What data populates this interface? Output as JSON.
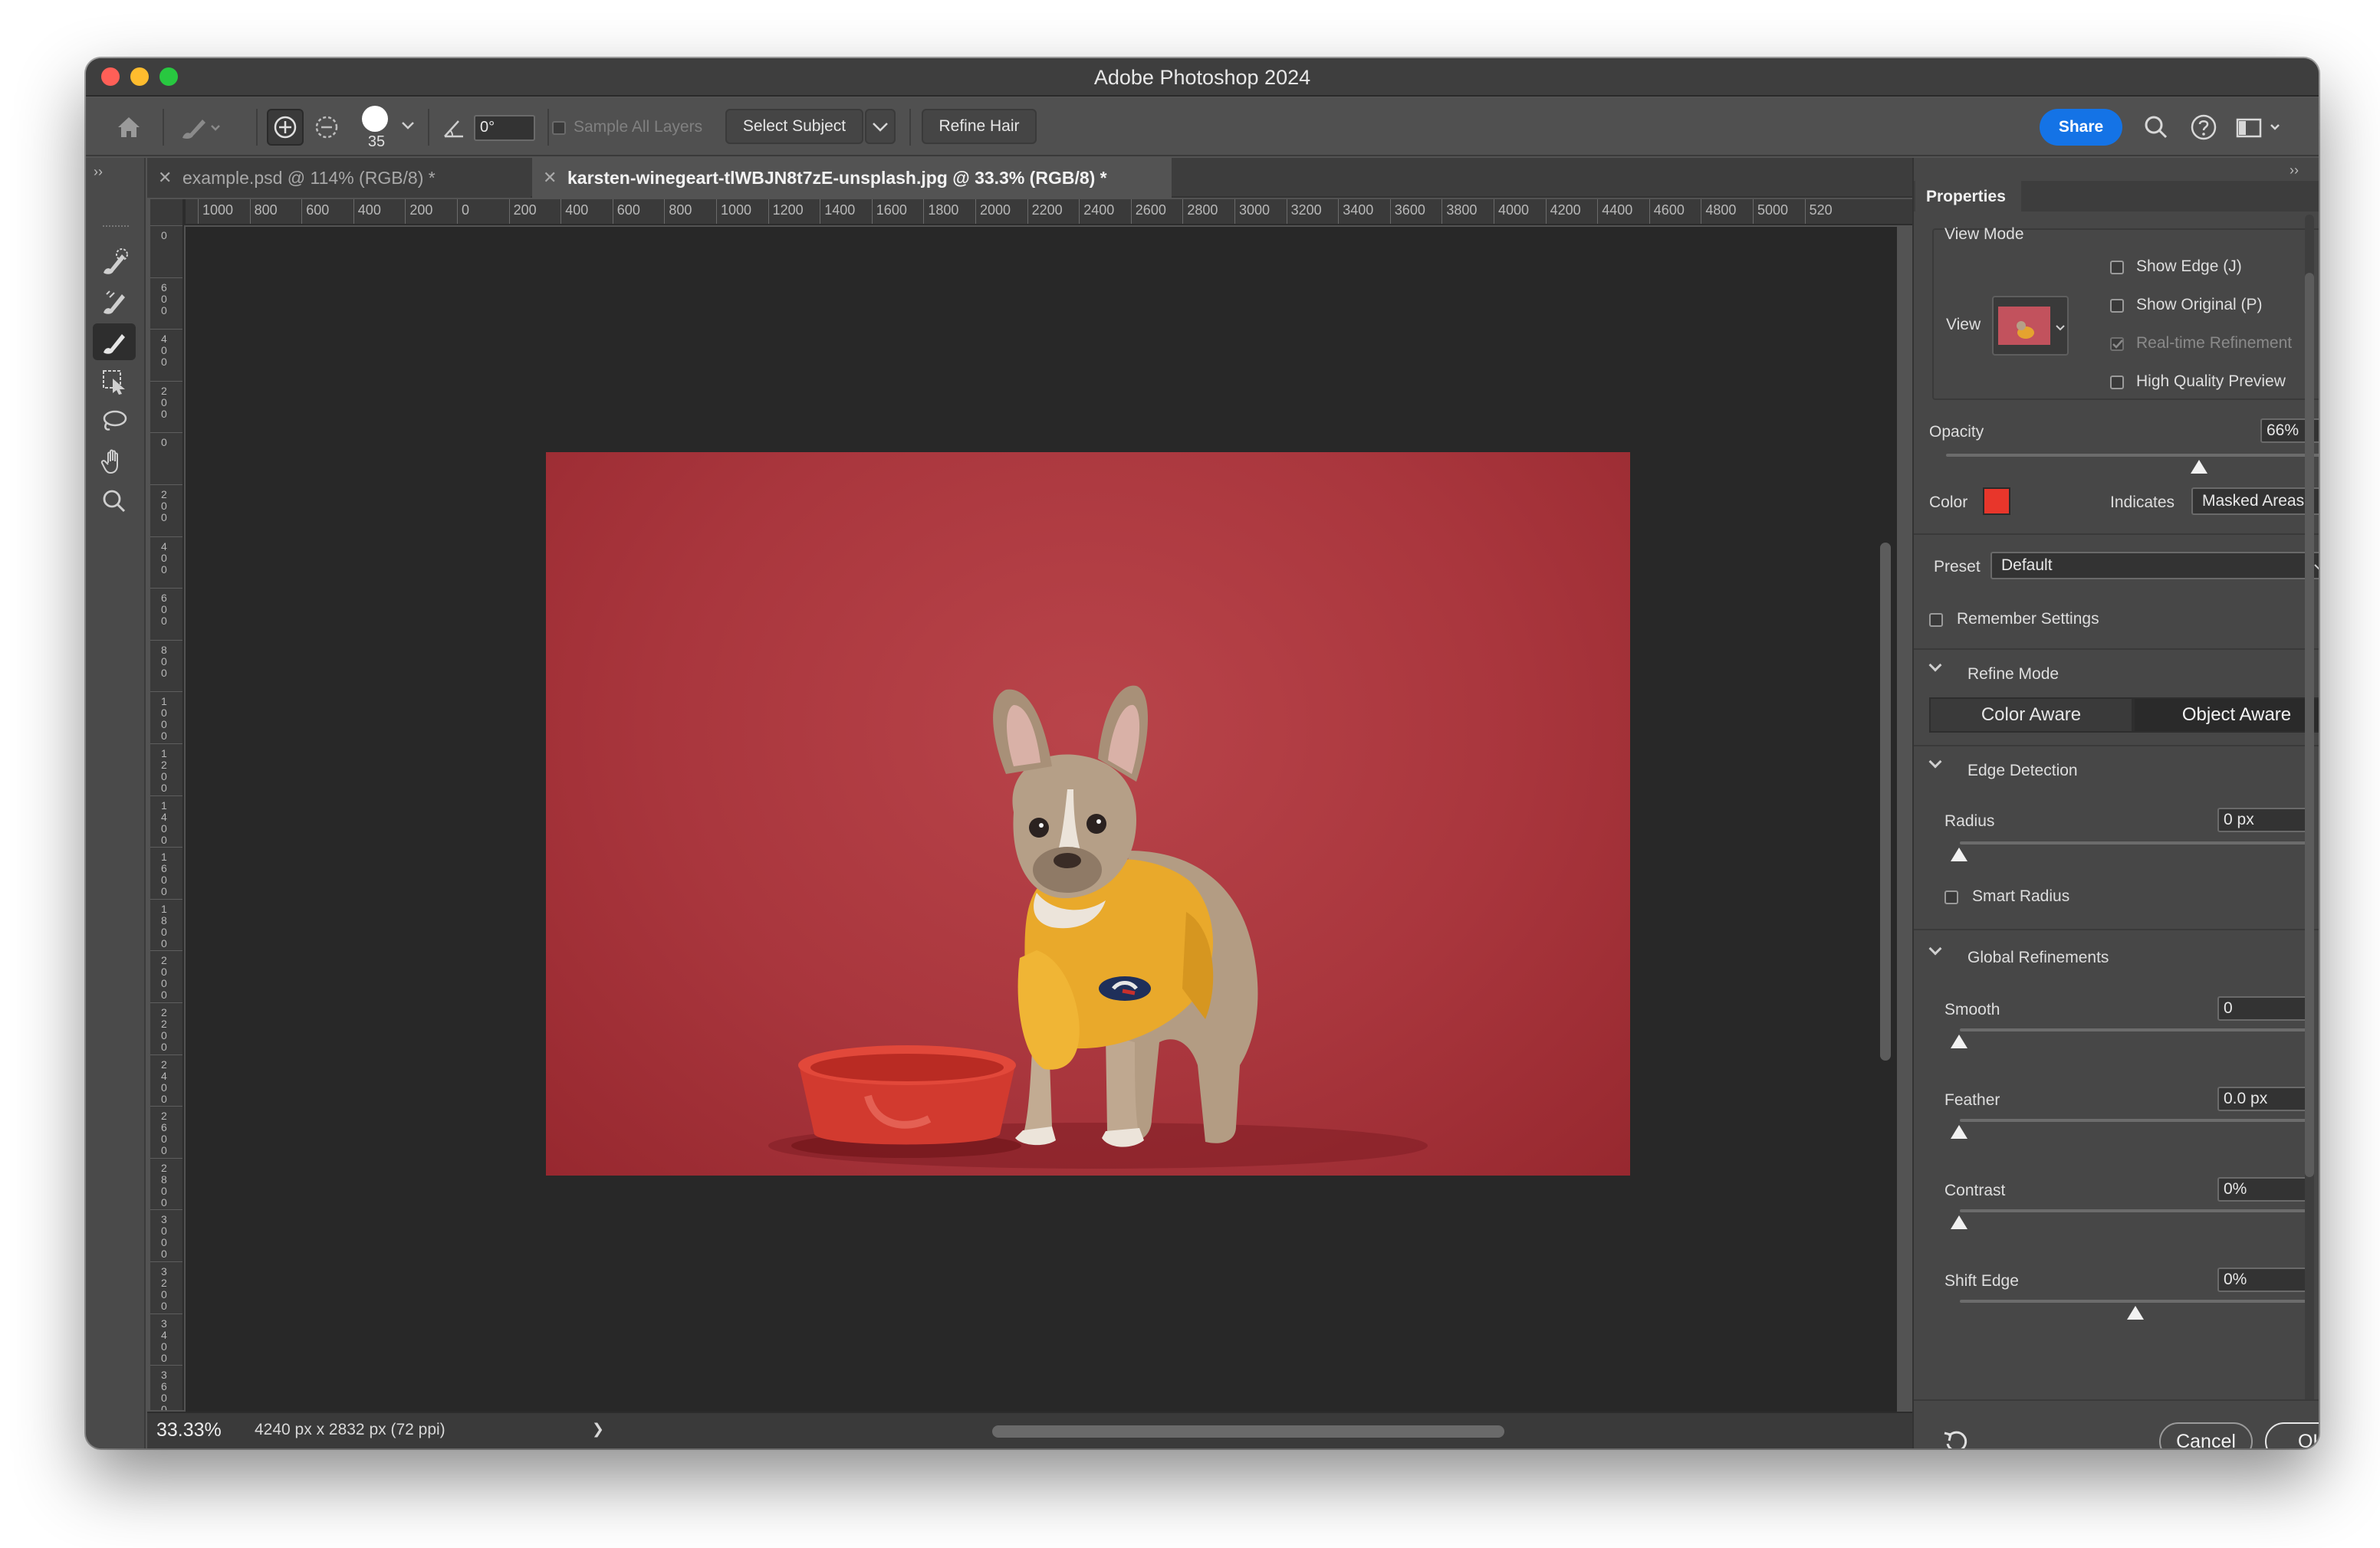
{
  "window": {
    "title": "Adobe Photoshop 2024"
  },
  "options_bar": {
    "brush_size": "35",
    "angle_value": "0°",
    "sample_all_layers": "Sample All Layers",
    "select_subject": "Select Subject",
    "refine_hair": "Refine Hair",
    "share": "Share"
  },
  "tabs": [
    {
      "label": "example.psd @ 114% (RGB/8) *",
      "active": false
    },
    {
      "label": "karsten-winegeart-tlWBJN8t7zE-unsplash.jpg @ 33.3% (RGB/8) *",
      "active": true
    }
  ],
  "ruler": {
    "horizontal": [
      "1000",
      "800",
      "600",
      "400",
      "200",
      "0",
      "200",
      "400",
      "600",
      "800",
      "1000",
      "1200",
      "1400",
      "1600",
      "1800",
      "2000",
      "2200",
      "2400",
      "2600",
      "2800",
      "3000",
      "3200",
      "3400",
      "3600",
      "3800",
      "4000",
      "4200",
      "4400",
      "4600",
      "4800",
      "5000",
      "520"
    ],
    "vertical": [
      "0",
      "600",
      "400",
      "200",
      "0",
      "200",
      "400",
      "600",
      "800",
      "1000",
      "1200",
      "1400",
      "1600",
      "1800",
      "2000",
      "2200",
      "2400",
      "2600",
      "2800",
      "3000",
      "3200",
      "3400",
      "3600"
    ]
  },
  "status": {
    "zoom": "33.33%",
    "doc_info": "4240 px x 2832 px (72 ppi)",
    "arrow": "❯"
  },
  "properties": {
    "tab_label": "Properties",
    "view_mode": {
      "title": "View Mode",
      "view_label": "View",
      "show_edge": "Show Edge (J)",
      "show_original": "Show Original (P)",
      "realtime": "Real-time Refinement",
      "hq_preview": "High Quality Preview"
    },
    "opacity": {
      "label": "Opacity",
      "value": "66%",
      "level": 0.66
    },
    "color": {
      "label": "Color",
      "swatch": "#e8362b",
      "indicates_label": "Indicates",
      "indicates_value": "Masked Areas"
    },
    "preset": {
      "label": "Preset",
      "value": "Default"
    },
    "remember_settings": "Remember Settings",
    "refine_mode": {
      "title": "Refine Mode",
      "color_aware": "Color Aware",
      "object_aware": "Object Aware"
    },
    "edge_detection": {
      "title": "Edge Detection",
      "radius_label": "Radius",
      "radius_value": "0 px",
      "smart_radius": "Smart Radius"
    },
    "global_refinements": {
      "title": "Global Refinements",
      "smooth_label": "Smooth",
      "smooth_value": "0",
      "feather_label": "Feather",
      "feather_value": "0.0 px",
      "contrast_label": "Contrast",
      "contrast_value": "0%",
      "shift_label": "Shift Edge",
      "shift_value": "0%"
    },
    "buttons": {
      "cancel": "Cancel",
      "ok": "OK"
    }
  },
  "colors": {
    "accent": "#1473e6",
    "canvas_bg": "#282828",
    "backdrop": "#a9363d"
  },
  "icons": [
    "home-icon",
    "brush-icon",
    "add-to-selection-icon",
    "subtract-from-selection-icon",
    "angle-icon",
    "search-icon",
    "help-icon",
    "workspace-icon",
    "quick-selection-icon",
    "refine-edge-brush-icon",
    "brush-tool-icon",
    "object-selection-icon",
    "lasso-icon",
    "hand-icon",
    "zoom-icon",
    "reset-icon"
  ]
}
